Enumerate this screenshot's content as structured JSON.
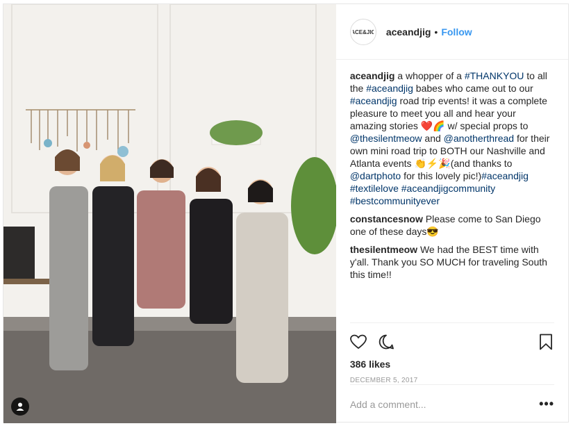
{
  "post": {
    "username": "aceandjig",
    "separator": "•",
    "follow_label": "Follow",
    "avatar_logo_text": "ACE&JIG",
    "caption": {
      "author": "aceandjig",
      "segments": [
        {
          "text": " a whopper of a ",
          "tag": false
        },
        {
          "text": "#THANKYOU",
          "tag": true
        },
        {
          "text": " to all the ",
          "tag": false
        },
        {
          "text": "#aceandjig",
          "tag": true
        },
        {
          "text": " babes who came out to our ",
          "tag": false
        },
        {
          "text": "#aceandjig",
          "tag": true
        },
        {
          "text": " road trip events! it was a complete pleasure to meet you all and hear your amazing stories ❤️🌈 w/ special props to ",
          "tag": false
        },
        {
          "text": "@thesilentmeow",
          "tag": true
        },
        {
          "text": " and ",
          "tag": false
        },
        {
          "text": "@anotherthread",
          "tag": true
        },
        {
          "text": " for their own mini road trip to BOTH our Nashville and Atlanta events 👏⚡🎉(and thanks to ",
          "tag": false
        },
        {
          "text": "@dartphoto",
          "tag": true
        },
        {
          "text": " for this lovely pic!)",
          "tag": false
        },
        {
          "text": "#aceandjig",
          "tag": true
        },
        {
          "text": " ",
          "tag": false
        },
        {
          "text": "#textilelove",
          "tag": true
        },
        {
          "text": " ",
          "tag": false
        },
        {
          "text": "#aceandjigcommunity",
          "tag": true
        },
        {
          "text": " ",
          "tag": false
        },
        {
          "text": "#bestcommunityever",
          "tag": true
        }
      ]
    },
    "comments": [
      {
        "author": "constancesnow",
        "text": " Please come to San Diego one of these days😎"
      },
      {
        "author": "thesilentmeow",
        "text": " We had the BEST time with y'all. Thank you SO MUCH for traveling South this time!!"
      }
    ],
    "likes": "386 likes",
    "date": "DECEMBER 5, 2017",
    "add_comment_placeholder": "Add a comment...",
    "more_label": "•••",
    "icons": {
      "like": "heart-icon",
      "comment": "comment-bubble-icon",
      "save": "bookmark-icon",
      "user_tag": "person-tag-icon"
    },
    "colors": {
      "link": "#003569",
      "follow": "#3897f0",
      "muted": "#999999"
    }
  }
}
